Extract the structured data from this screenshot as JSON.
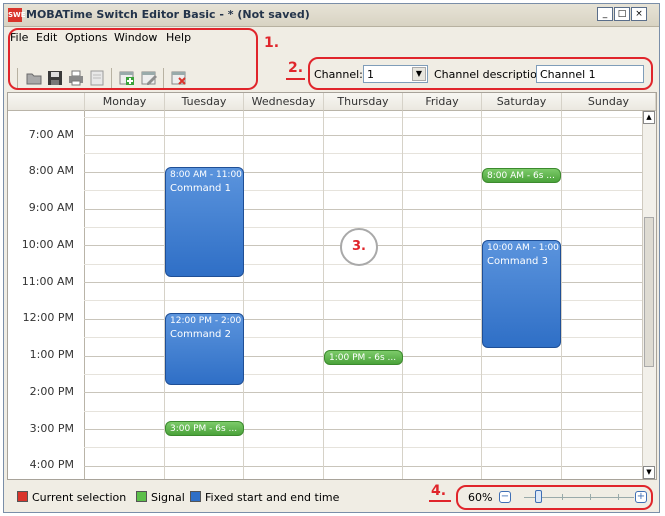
{
  "window": {
    "title": "MOBATime Switch Editor Basic - * (Not saved)",
    "app_icon": "SWE",
    "controls": [
      "_",
      "□",
      "×"
    ]
  },
  "menu": [
    "File",
    "Edit",
    "Options",
    "Window",
    "Help"
  ],
  "toolbar": {
    "icons": [
      "open-icon",
      "save-icon",
      "print-icon",
      "print-preview-icon",
      "add-command-icon",
      "edit-command-icon",
      "delete-command-icon"
    ]
  },
  "channel": {
    "label": "Channel:",
    "value": "1",
    "description_label": "Channel description:",
    "description_value": "Channel 1"
  },
  "annotations": [
    "1.",
    "2.",
    "3.",
    "4."
  ],
  "calendar": {
    "days": [
      "Monday",
      "Tuesday",
      "Wednesday",
      "Thursday",
      "Friday",
      "Saturday",
      "Sunday"
    ],
    "times": [
      "7:00 AM",
      "8:00 AM",
      "9:00 AM",
      "10:00 AM",
      "11:00 AM",
      "12:00 PM",
      "1:00 PM",
      "2:00 PM",
      "3:00 PM",
      "4:00 PM"
    ],
    "events": [
      {
        "day": "Tuesday",
        "time": "8:00 AM - 11:00 A",
        "command": "Command 1",
        "type": "fixed"
      },
      {
        "day": "Tuesday",
        "time": "12:00 PM - 2:00 P",
        "command": "Command 2",
        "type": "fixed"
      },
      {
        "day": "Tuesday",
        "time": "3:00 PM - 6s ...",
        "type": "signal"
      },
      {
        "day": "Thursday",
        "time": "1:00 PM - 6s ...",
        "type": "signal"
      },
      {
        "day": "Saturday",
        "time": "8:00 AM - 6s ...",
        "type": "signal"
      },
      {
        "day": "Saturday",
        "time": "10:00 AM - 1:00 P",
        "command": "Command 3",
        "type": "fixed"
      }
    ]
  },
  "legend": [
    {
      "label": "Current selection",
      "color": "#d9342b"
    },
    {
      "label": "Signal",
      "color": "#5cbf4a"
    },
    {
      "label": "Fixed start and end time",
      "color": "#2f6fc6"
    }
  ],
  "zoom": {
    "value": "60%",
    "level": 0.6
  },
  "colors": {
    "annotation": "#e0252b",
    "fixed_event": "#2f6fc6",
    "signal_event": "#4aa23a"
  }
}
